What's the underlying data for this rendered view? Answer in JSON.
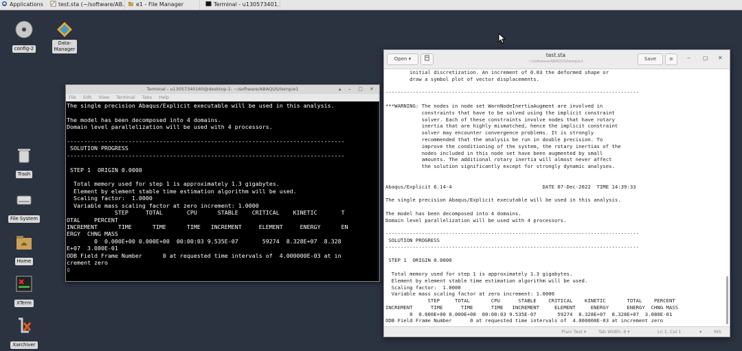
{
  "panel": {
    "apps_label": "Applications",
    "tasks": [
      "test.sta (~/software/AB...",
      "e1 - File Manager",
      "Terminal - u130573401..."
    ]
  },
  "desktop": {
    "icons": [
      "config-2",
      "Data-\nManager",
      "Trash",
      "File System",
      "Home",
      "XTerm",
      "Xarchiver"
    ]
  },
  "terminal": {
    "title": "Terminal - u13057340160@desktop-1: ~/software/ABAQUS/temp/e1",
    "controls": "▴ ‒ ▢ ✕",
    "menu": [
      "File",
      "Edit",
      "View",
      "Terminal",
      "Tabs",
      "Help"
    ],
    "content": "The single precision Abaqus/Explicit executable will be used in this analysis.\n\nThe model has been decomposed into 4 domains.\nDomain level parallelization will be used with 4 processors.\n\n---------------------------------------------------------------------------------\n SOLUTION PROGRESS\n---------------------------------------------------------------------------------\n\n STEP 1  ORIGIN 0.0000\n\n  Total memory used for step 1 is approximately 1.3 gigabytes.\n  Element by element stable time estimation algorithm will be used.\n  Scaling factor:  1.0000\n  Variable mass scaling factor at zero increment: 1.0000\n              STEP     TOTAL       CPU      STABLE    CRITICAL    KINETIC       T\nOTAL    PERCENT\nINCREMENT      TIME      TIME      TIME   INCREMENT     ELEMENT     ENERGY      EN\nERGY  CHNG MASS\n        0  0.000E+00 0.000E+00  00:00:03 9.535E-07       59274  8.328E+07  8.328\nE+07  3.080E-01\nODB Field Frame Number      0 at requested time intervals of  4.000000E-03 at in\ncrement zero\n▯"
  },
  "editor": {
    "open_label": "Open ▾",
    "title": "test.sta",
    "subtitle": "~/software/ABAQUS/temp/e1",
    "save_label": "Save",
    "controls": [
      "≡",
      "‒",
      "▢",
      "✕"
    ],
    "content": "        initial discretization. An increment of 0.03 the deformed shape or\n        draw a symbol plot of vector displacements.\n\n------------------------------------------------------------------------------------\n\n***WARNING: The nodes in node set WarnNodeInertiaAugment are involved in\n            constraints that have to be solved using the implicit constraint\n            solver. Each of these constraints involve nodes that have rotary\n            inertia that are highly mismatched, hence the implicit constraint\n            solver may encounter convergence problems. It is strongly\n            recommended that the analysis be run in double precision. To\n            improve the conditioning of the system, the rotary inertias of the\n            nodes included in this node set have been augmented by small\n            amounts. The additional rotary inertia will almost never affect\n            the solution significantly except for strongly dynamic analyses.\n\n\nAbaqus/Explicit 6.14-4                              DATE 07-Dec-2022  TIME 14:39:33\n\nThe single precision Abaqus/Explicit executable will be used in this analysis.\n\nThe model has been decomposed into 4 domains.\nDomain level parallelization will be used with 4 processors.\n\n------------------------------------------------------------------------------------\n SOLUTION PROGRESS\n------------------------------------------------------------------------------------\n\n STEP 1  ORIGIN 0.0000\n\n  Total memory used for step 1 is approximately 1.3 gigabytes.\n  Element by element stable time estimation algorithm will be used.\n  Scaling factor:  1.0000\n  Variable mass scaling factor at zero increment: 1.0000\n              STEP     TOTAL       CPU      STABLE    CRITICAL    KINETIC       TOTAL    PERCENT\nINCREMENT      TIME      TIME      TIME   INCREMENT     ELEMENT     ENERGY      ENERGY  CHNG MASS\n        0  0.000E+00 0.000E+00  00:00:03 9.535E-07       59274  8.328E+07  8.328E+07  3.080E-01\nODB Field Frame Number      0 at requested time intervals of  4.000000E-03 at increment zero",
    "status": {
      "syntax": "Plain Text ▾",
      "tab_width": "Tab Width: 8 ▾",
      "position": "Ln 1, Col 1",
      "mode_arrow": "▾",
      "ins": "INS"
    }
  },
  "colors": {
    "desktop_bg": "#2b3240",
    "terminal_bg": "#000000",
    "terminal_fg": "#ffffff",
    "editor_bg": "#ffffff"
  }
}
